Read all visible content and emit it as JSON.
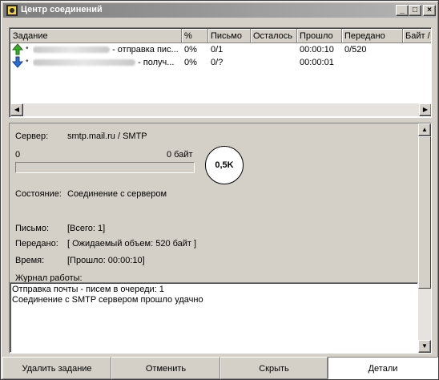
{
  "window": {
    "title": "Центр соединений",
    "buttons": {
      "minimize": "_",
      "maximize": "□",
      "close": "×"
    }
  },
  "task_list": {
    "columns": [
      "Задание",
      "%",
      "Письмо",
      "Осталось",
      "Прошло",
      "Передано",
      "Байт /"
    ],
    "rows": [
      {
        "direction_icon": "green-up-arrow-icon",
        "task_suffix": "- отправка пис...",
        "percent": "0%",
        "letter": "0/1",
        "remaining": "",
        "elapsed": "00:00:10",
        "transferred": "0/520",
        "bytes": ""
      },
      {
        "direction_icon": "blue-down-arrow-icon",
        "task_suffix": "- получ...",
        "percent": "0%",
        "letter": "0/?",
        "remaining": "",
        "elapsed": "00:00:01",
        "transferred": "",
        "bytes": ""
      }
    ]
  },
  "details": {
    "server_label": "Сервер:",
    "server_value": "smtp.mail.ru / SMTP",
    "progress_left": "0",
    "progress_right": "0 байт",
    "progress_fraction": 0,
    "rate": "0,5K",
    "state_label": "Состояние:",
    "state_value": "Соединение с сервером",
    "letter_label": "Письмо:",
    "letter_value": "[Всего: 1]",
    "transferred_label": "Передано:",
    "transferred_value": "[ Ожидаемый объем: 520 байт ]",
    "time_label": "Время:",
    "time_value": "[Прошло: 00:00:10]",
    "log_label": "Журнал работы:",
    "log_lines": [
      "Отправка почты - писем в очереди: 1",
      "Соединение с SMTP сервером прошло удачно"
    ]
  },
  "bottom_buttons": {
    "delete_task": "Удалить задание",
    "cancel": "Отменить",
    "hide": "Скрыть",
    "details": "Детали"
  }
}
